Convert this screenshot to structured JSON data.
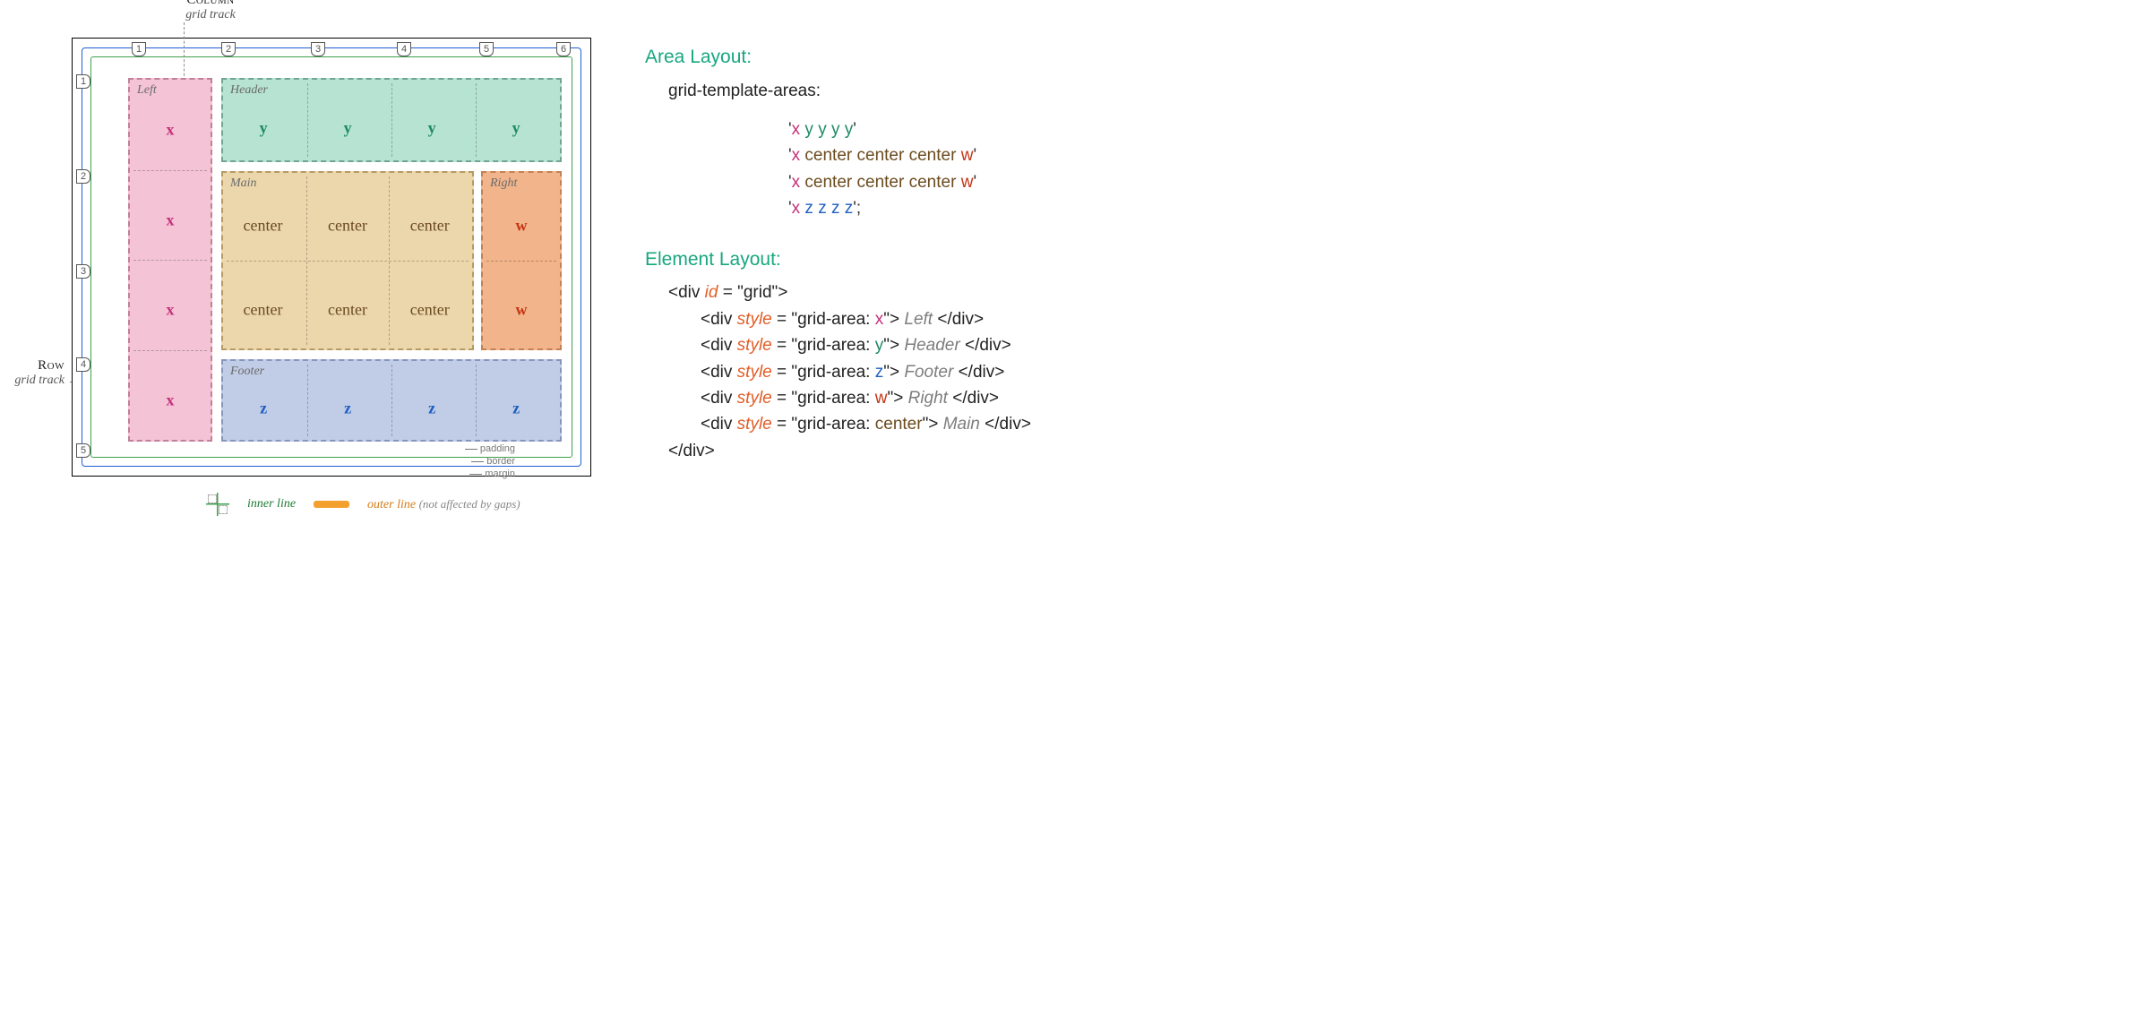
{
  "labels": {
    "column_caps": "Column",
    "column_sub": "grid track",
    "row_caps": "Row",
    "row_sub": "grid track",
    "padding": "padding",
    "border": "border",
    "margin": "margin",
    "inner_line": "inner line",
    "outer_line": "outer line",
    "outer_note": "(not affected by gaps)"
  },
  "line_numbers": {
    "cols": [
      "1",
      "2",
      "3",
      "4",
      "5",
      "6"
    ],
    "rows": [
      "1",
      "2",
      "3",
      "4",
      "5"
    ]
  },
  "areas": {
    "x": {
      "tag": "Left",
      "token": "x"
    },
    "y": {
      "tag": "Header",
      "token": "y"
    },
    "c": {
      "tag": "Main",
      "token": "center"
    },
    "w": {
      "tag": "Right",
      "token": "w"
    },
    "z": {
      "tag": "Footer",
      "token": "z"
    }
  },
  "right": {
    "area_heading": "Area Layout:",
    "gta_prop": "grid-template-areas:",
    "template_rows": [
      [
        [
          "x",
          "x"
        ],
        [
          "y",
          "y"
        ],
        [
          "y",
          "y"
        ],
        [
          "y",
          "y"
        ],
        [
          "y",
          "y"
        ]
      ],
      [
        [
          "x",
          "x"
        ],
        [
          "c",
          "center"
        ],
        [
          "c",
          "center"
        ],
        [
          "c",
          "center"
        ],
        [
          "w",
          "w"
        ]
      ],
      [
        [
          "x",
          "x"
        ],
        [
          "c",
          "center"
        ],
        [
          "c",
          "center"
        ],
        [
          "c",
          "center"
        ],
        [
          "w",
          "w"
        ]
      ],
      [
        [
          "x",
          "x"
        ],
        [
          "z",
          "z"
        ],
        [
          "z",
          "z"
        ],
        [
          "z",
          "z"
        ],
        [
          "z",
          "z"
        ]
      ]
    ],
    "element_heading": "Element Layout:",
    "code": {
      "open": "<div id = \"grid\">",
      "children": [
        {
          "area": "x",
          "cls": "x",
          "text": "Left"
        },
        {
          "area": "y",
          "cls": "y",
          "text": "Header"
        },
        {
          "area": "z",
          "cls": "z",
          "text": "Footer"
        },
        {
          "area": "w",
          "cls": "w",
          "text": "Right"
        },
        {
          "area": "center",
          "cls": "c",
          "text": "Main"
        }
      ],
      "close": "</div>"
    }
  }
}
